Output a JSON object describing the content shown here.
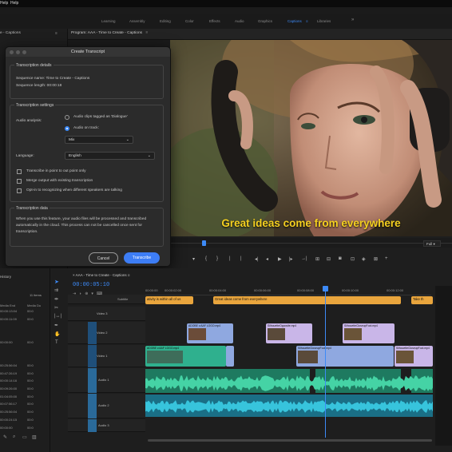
{
  "menubar": {
    "item": "Help",
    "item2": "Help"
  },
  "workspaces": [
    "Learning",
    "Assembly",
    "Editing",
    "Color",
    "Effects",
    "Audio",
    "Graphics",
    "Captions",
    "Libraries"
  ],
  "workspace_active": "Captions",
  "monitor": {
    "header": "Program: AAA - Time to Create - Captions",
    "caption": "Great ideas come from everywhere",
    "fit": "Full"
  },
  "left_header": "e - Captions",
  "dialog": {
    "title": "Create Transcript",
    "details": {
      "title": "Transcription details",
      "seq_name": "Sequence name: Time to Create - Captions",
      "seq_length": "Sequence length: 00:00:18"
    },
    "settings": {
      "title": "Transcription settings",
      "audio_analysis": "Audio analysis:",
      "opt_dialogue": "Audio clips tagged as 'Dialogue'",
      "opt_track": "Audio on track:",
      "track_value": "Mix",
      "language_label": "Language:",
      "language_value": "English",
      "cb1": "Transcribe in point to out point only",
      "cb2": "Merge output with existing transcription",
      "cb3": "Opt-in to recognizing when different speakers are talking"
    },
    "data": {
      "title": "Transcription data",
      "text": "When you use this feature, your audio files will be processed and transcribed automatically in the cloud. This process can not be cancelled once sent for transcription."
    },
    "cancel": "Cancel",
    "transcribe": "Transcribe"
  },
  "project": {
    "header": "History",
    "items_label": "11 items",
    "col1": "Media End",
    "col2": "Media Du",
    "rows": [
      [
        "00:00:13:04",
        "00:0"
      ],
      [
        "00:00:11:09",
        "00:0"
      ],
      [
        "",
        ""
      ],
      [
        "",
        ""
      ],
      [
        "00:00:00",
        "00:0"
      ],
      [
        "",
        ""
      ],
      [
        "",
        ""
      ],
      [
        "00:25:56:04",
        "00:0"
      ],
      [
        "00:47:26:19",
        "00:0"
      ],
      [
        "00:00:14:16",
        "00:0"
      ],
      [
        "00:09:26:00",
        "00:0"
      ],
      [
        "01:04:05:00",
        "00:0"
      ],
      [
        "00:07:56:17",
        "00:0"
      ],
      [
        "00:25:56:04",
        "00:0"
      ],
      [
        "00:00:24:15",
        "00:0"
      ],
      [
        "00:00:00",
        "00:0"
      ]
    ]
  },
  "timeline": {
    "tab": "AAA - Time to Create - Captions",
    "timecode": "00:00:05:10",
    "subtitle": "Subtitle",
    "ruler": [
      "00:00:00",
      "00:00:02:00",
      "00:00:04:00",
      "00:00:06:00",
      "00:00:08:00",
      "00:00:10:00",
      "00:00:12:00"
    ],
    "captions": [
      "ativity is within all of us",
      "Great ideas come from everywhere",
      "Take th"
    ],
    "video_clips": [
      {
        "label": "ADOBE v.AAF LOGO.mp4",
        "track": "V2",
        "color": "#8fa8e0"
      },
      {
        "label": "SilhouetteOpposite.mp4",
        "track": "V2",
        "color": "#c9b6e8"
      },
      {
        "label": "SilhouetteCloseupFoot.mp4",
        "track": "V2",
        "color": "#c9b6e8"
      },
      {
        "label": "ADOBE v.AAF LOGO.mp4",
        "track": "V1",
        "color": "#2fb08e"
      },
      {
        "label": "SilhouetteCloseupFoot.mp4",
        "track": "V1",
        "color": "#8fa8e0"
      },
      {
        "label": "SilhouetteCloseupFoot.mp4",
        "track": "V1",
        "color": "#c9b6e8"
      }
    ],
    "tracks": {
      "v3": "Video 3",
      "v2": "Video 2",
      "v1": "Video 1",
      "a1": "Audio 1",
      "a2": "Audio 2",
      "a3": "Audio 3"
    }
  },
  "colors": {
    "accent": "#3d8af7",
    "caption": "#f5d020",
    "audio_green": "#2db98d",
    "audio_teal": "#1fa5bd"
  }
}
